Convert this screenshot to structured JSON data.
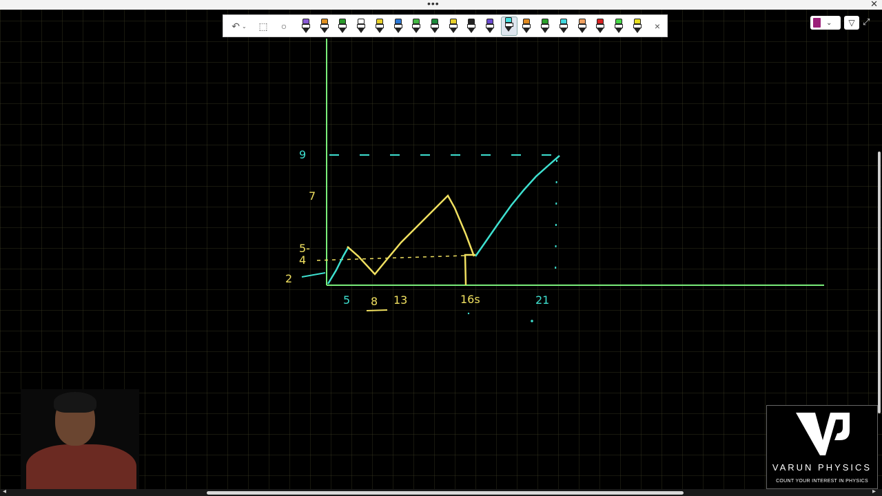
{
  "toolbar": {
    "undo_icon": "undo-icon",
    "tools": [
      "lasso-select-icon",
      "magnifier-icon"
    ],
    "pens": [
      {
        "color": "#8a5ad6"
      },
      {
        "color": "#e09020"
      },
      {
        "color": "#2a9a2a"
      },
      {
        "color": "#ffffff"
      },
      {
        "color": "#e8d02a"
      },
      {
        "color": "#2a78d6"
      },
      {
        "color": "#42b842"
      },
      {
        "color": "#1b8a3a"
      },
      {
        "color": "#e8d02a"
      },
      {
        "color": "#222222"
      },
      {
        "color": "#6a4ad0"
      },
      {
        "color": "#48e0e0",
        "selected": true
      },
      {
        "color": "#e08a20"
      },
      {
        "color": "#2aa02a"
      },
      {
        "color": "#40d8e0"
      },
      {
        "color": "#f0a060"
      },
      {
        "color": "#d82020"
      },
      {
        "color": "#48d848"
      },
      {
        "color": "#e8e020"
      }
    ],
    "close_label": "×"
  },
  "graph": {
    "y_labels": {
      "nine": "9",
      "seven": "7",
      "five": "5-",
      "four": "4",
      "two": "2"
    },
    "x_labels": {
      "five": "5",
      "eight": "8",
      "thirteen": "13",
      "sixteen": "16s",
      "twentyone": "21"
    }
  },
  "logo": {
    "name": "VARUN  PHYSICS",
    "tagline": "COUNT YOUR INTEREST IN PHYSICS"
  },
  "colors": {
    "cyan": "#3ee0d0",
    "yellow": "#f0e060",
    "axis": "#7aee7a"
  }
}
